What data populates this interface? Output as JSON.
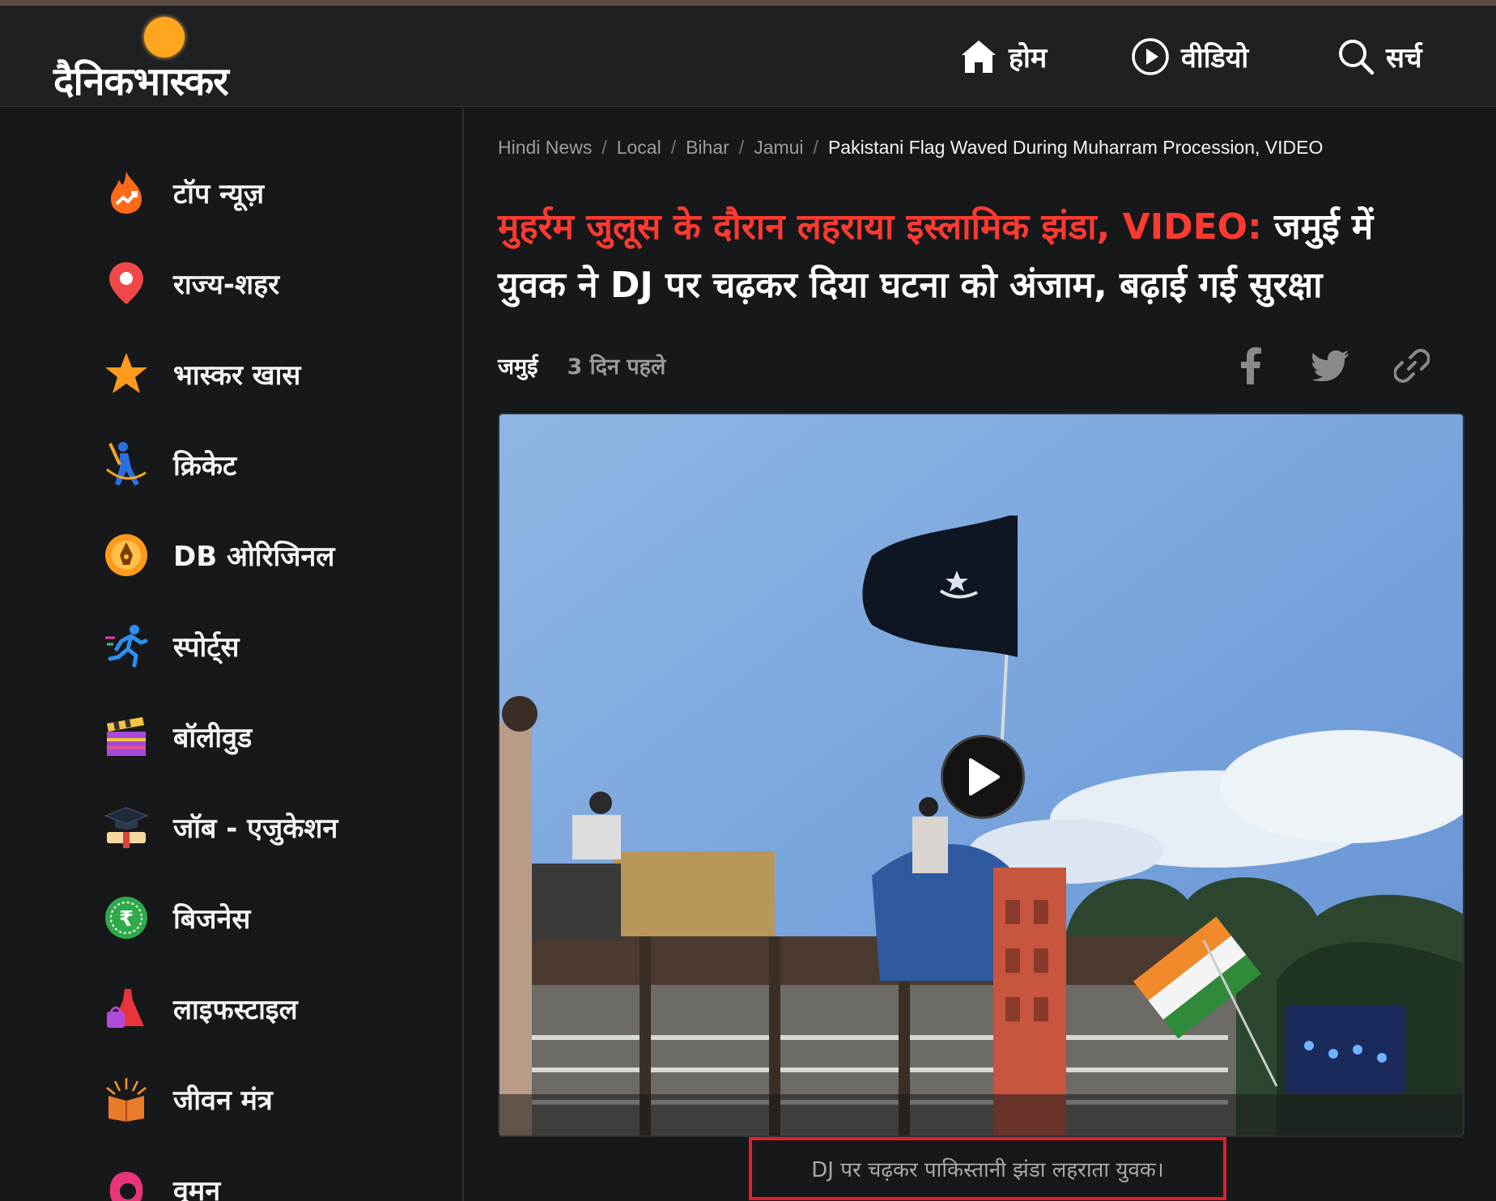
{
  "header": {
    "logo_text": "दैनिकभास्कर",
    "nav": [
      {
        "label": "होम",
        "icon": "home-icon"
      },
      {
        "label": "वीडियो",
        "icon": "play-circle-icon"
      },
      {
        "label": "सर्च",
        "icon": "search-icon"
      }
    ]
  },
  "sidebar": {
    "items": [
      {
        "label": "टॉप न्यूज़",
        "icon": "fire-trending-icon"
      },
      {
        "label": "राज्य-शहर",
        "icon": "location-pin-icon"
      },
      {
        "label": "भास्कर खास",
        "icon": "star-icon"
      },
      {
        "label": "क्रिकेट",
        "icon": "cricket-player-icon"
      },
      {
        "label": "DB ओरिजिनल",
        "icon": "pen-nib-icon"
      },
      {
        "label": "स्पोर्ट्स",
        "icon": "runner-icon"
      },
      {
        "label": "बॉलीवुड",
        "icon": "clapperboard-icon"
      },
      {
        "label": "जॉब - एजुकेशन",
        "icon": "graduation-cap-icon"
      },
      {
        "label": "बिजनेस",
        "icon": "rupee-coin-icon"
      },
      {
        "label": "लाइफस्टाइल",
        "icon": "dress-icon"
      },
      {
        "label": "जीवन मंत्र",
        "icon": "book-icon"
      },
      {
        "label": "वुमन",
        "icon": "woman-icon"
      }
    ]
  },
  "breadcrumb": {
    "items": [
      "Hindi News",
      "Local",
      "Bihar",
      "Jamui"
    ],
    "separator": "/",
    "current": "Pakistani Flag Waved During Muharram Procession, VIDEO"
  },
  "article": {
    "headline_highlight": "मुहर्रम जुलूस के दौरान लहराया इस्लामिक झंडा, VIDEO:",
    "headline_rest": " जमुई में युवक ने DJ पर चढ़कर दिया घटना को अंजाम, बढ़ाई गई सुरक्षा",
    "location": "जमुई",
    "time": "3 दिन पहले",
    "caption": "DJ पर चढ़कर पाकिस्तानी झंडा लहराता युवक।"
  },
  "share": [
    "facebook-icon",
    "twitter-icon",
    "link-icon"
  ],
  "colors": {
    "accent_red": "#ff3a30",
    "sun": "#ffa51e",
    "background": "#17181a",
    "highlight_box": "#e0202a"
  }
}
